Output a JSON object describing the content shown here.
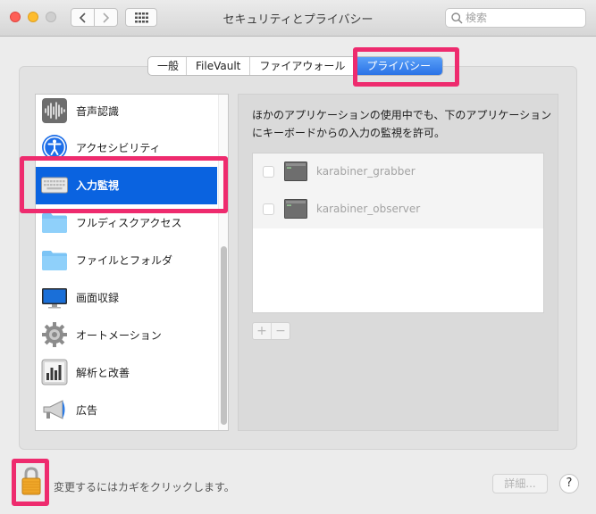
{
  "window": {
    "title": "セキュリティとプライバシー"
  },
  "search": {
    "placeholder": "検索"
  },
  "tabs": [
    {
      "label": "一般"
    },
    {
      "label": "FileVault"
    },
    {
      "label": "ファイアウォール"
    },
    {
      "label": "プライバシー",
      "selected": true
    }
  ],
  "sidebar": {
    "items": [
      {
        "label": "音声認識",
        "icon": "speech-recognition-icon"
      },
      {
        "label": "アクセシビリティ",
        "icon": "accessibility-icon"
      },
      {
        "label": "入力監視",
        "icon": "keyboard-icon",
        "selected": true
      },
      {
        "label": "フルディスクアクセス",
        "icon": "folder-icon"
      },
      {
        "label": "ファイルとフォルダ",
        "icon": "folder-icon"
      },
      {
        "label": "画面収録",
        "icon": "display-icon"
      },
      {
        "label": "オートメーション",
        "icon": "gear-icon"
      },
      {
        "label": "解析と改善",
        "icon": "analytics-icon"
      },
      {
        "label": "広告",
        "icon": "megaphone-icon"
      }
    ]
  },
  "main": {
    "description": "ほかのアプリケーションの使用中でも、下のアプリケーションにキーボードからの入力の監視を許可。",
    "apps": [
      {
        "name": "karabiner_grabber",
        "checked": false,
        "icon": "terminal-icon"
      },
      {
        "name": "karabiner_observer",
        "checked": false,
        "icon": "terminal-icon"
      }
    ],
    "add_label": "+",
    "remove_label": "−"
  },
  "footer": {
    "lock_text": "変更するにはカギをクリックします。",
    "details_label": "詳細...",
    "help_label": "?"
  },
  "colors": {
    "accent": "#0a63e0",
    "highlight": "#ee2b6e"
  }
}
